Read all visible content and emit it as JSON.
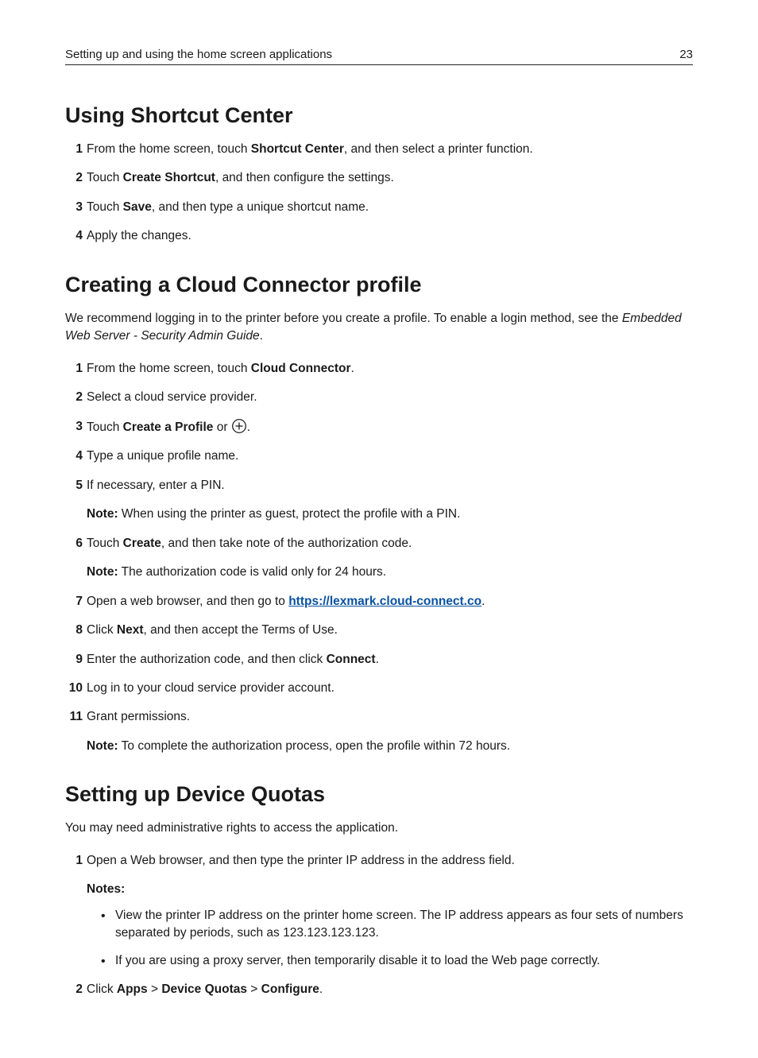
{
  "header": {
    "left": "Setting up and using the home screen applications",
    "page": "23"
  },
  "sections": {
    "shortcut": {
      "heading": "Using Shortcut Center",
      "steps": [
        {
          "n": "1",
          "pre": "From the home screen, touch ",
          "b1": "Shortcut Center",
          "post": ", and then select a printer function."
        },
        {
          "n": "2",
          "pre": "Touch ",
          "b1": "Create Shortcut",
          "post": ", and then configure the settings."
        },
        {
          "n": "3",
          "pre": "Touch ",
          "b1": "Save",
          "post": ", and then type a unique shortcut name."
        },
        {
          "n": "4",
          "text": "Apply the changes."
        }
      ]
    },
    "cloud": {
      "heading": "Creating a Cloud Connector profile",
      "intro_a": "We recommend logging in to the printer before you create a profile. To enable a login method, see the ",
      "intro_em": "Embedded Web Server - Security Admin Guide",
      "intro_b": ".",
      "link_text": "https://lexmark.cloud-connect.co",
      "steps": {
        "s1": {
          "n": "1",
          "pre": "From the home screen, touch ",
          "b1": "Cloud Connector",
          "post": "."
        },
        "s2": {
          "n": "2",
          "text": "Select a cloud service provider."
        },
        "s3": {
          "n": "3",
          "pre": "Touch ",
          "b1": "Create a Profile",
          "mid": " or ",
          "post": "."
        },
        "s4": {
          "n": "4",
          "text": "Type a unique profile name."
        },
        "s5": {
          "n": "5",
          "text": "If necessary, enter a PIN.",
          "note_b": "Note:",
          "note": " When using the printer as guest, protect the profile with a PIN."
        },
        "s6": {
          "n": "6",
          "pre": "Touch ",
          "b1": "Create",
          "post": ", and then take note of the authorization code.",
          "note_b": "Note:",
          "note": " The authorization code is valid only for 24 hours."
        },
        "s7": {
          "n": "7",
          "pre": "Open a web browser, and then go to ",
          "post": "."
        },
        "s8": {
          "n": "8",
          "pre": "Click ",
          "b1": "Next",
          "post": ", and then accept the Terms of Use."
        },
        "s9": {
          "n": "9",
          "pre": "Enter the authorization code, and then click ",
          "b1": "Connect",
          "post": "."
        },
        "s10": {
          "n": "10",
          "text": "Log in to your cloud service provider account."
        },
        "s11": {
          "n": "11",
          "text": "Grant permissions.",
          "note_b": "Note:",
          "note": " To complete the authorization process, open the profile within 72 hours."
        }
      }
    },
    "quotas": {
      "heading": "Setting up Device Quotas",
      "intro": "You may need administrative rights to access the application.",
      "steps": {
        "s1": {
          "n": "1",
          "text": "Open a Web browser, and then type the printer IP address in the address field.",
          "notes_label": "Notes:",
          "bullets": [
            "View the printer IP address on the printer home screen. The IP address appears as four sets of numbers separated by periods, such as 123.123.123.123.",
            "If you are using a proxy server, then temporarily disable it to load the Web page correctly."
          ]
        },
        "s2": {
          "n": "2",
          "pre": "Click ",
          "b1": "Apps",
          "sep1": " > ",
          "b2": "Device Quotas",
          "sep2": " > ",
          "b3": "Configure",
          "post": "."
        }
      }
    }
  }
}
